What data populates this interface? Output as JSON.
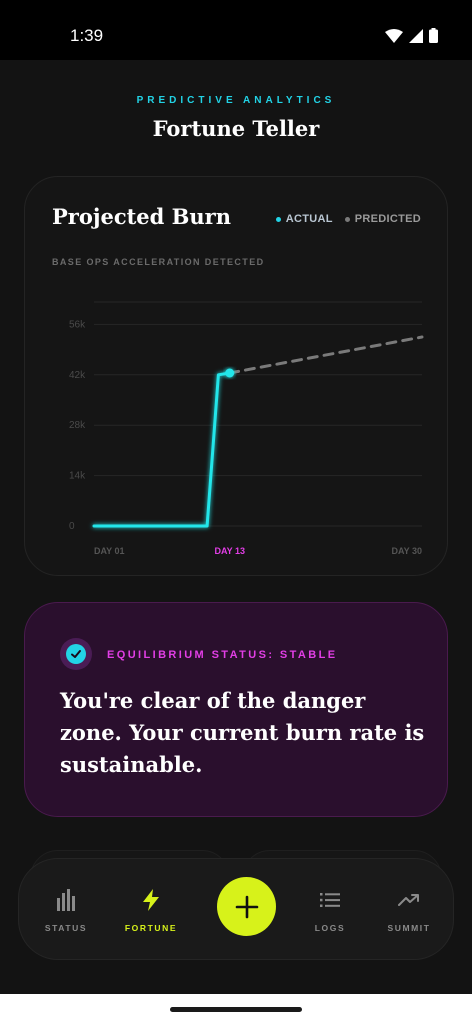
{
  "status_bar": {
    "time": "1:39"
  },
  "header": {
    "eyebrow": "PREDICTIVE ANALYTICS",
    "title": "Fortune Teller"
  },
  "burn_card": {
    "title": "Projected Burn",
    "subtitle": "BASE OPS ACCELERATION DETECTED",
    "legend": {
      "actual": "ACTUAL",
      "predicted": "PREDICTED"
    }
  },
  "chart_data": {
    "type": "line",
    "title": "Projected Burn",
    "subtitle": "BASE OPS ACCELERATION DETECTED",
    "y_ticks": [
      "0",
      "14k",
      "28k",
      "42k",
      "56k"
    ],
    "y_tick_values": [
      0,
      14000,
      28000,
      42000,
      56000
    ],
    "ylim": [
      0,
      60000
    ],
    "x_ticks": [
      "DAY 01",
      "DAY 13",
      "DAY 30"
    ],
    "x_tick_values": [
      1,
      13,
      30
    ],
    "highlighted_x_tick": "DAY 13",
    "xlim": [
      1,
      30
    ],
    "grid": true,
    "legend_position": "top-right",
    "series": [
      {
        "name": "ACTUAL",
        "color": "#22e6ea",
        "style": "solid",
        "points": [
          [
            1,
            0
          ],
          [
            11,
            0
          ],
          [
            12,
            42000
          ],
          [
            13,
            42500
          ]
        ]
      },
      {
        "name": "PREDICTED",
        "color": "#7a7a7a",
        "style": "dashed",
        "points": [
          [
            13,
            42500
          ],
          [
            30,
            52500
          ]
        ]
      }
    ]
  },
  "status_card": {
    "label": "EQUILIBRIUM STATUS: STABLE",
    "message": "You're clear of the danger zone. Your current burn rate is sustainable."
  },
  "nav": {
    "items": [
      {
        "label": "STATUS",
        "icon": "bar-chart-icon"
      },
      {
        "label": "FORTUNE",
        "icon": "lightning-icon",
        "active": true
      },
      {
        "label": "LOGS",
        "icon": "list-icon"
      },
      {
        "label": "SUMMIT",
        "icon": "trending-up-icon"
      }
    ],
    "fab_icon": "plus-icon"
  },
  "colors": {
    "accent_cyan": "#22d3e6",
    "accent_magenta": "#e23ee6",
    "accent_lime": "#d7f21a",
    "background": "#131313"
  }
}
